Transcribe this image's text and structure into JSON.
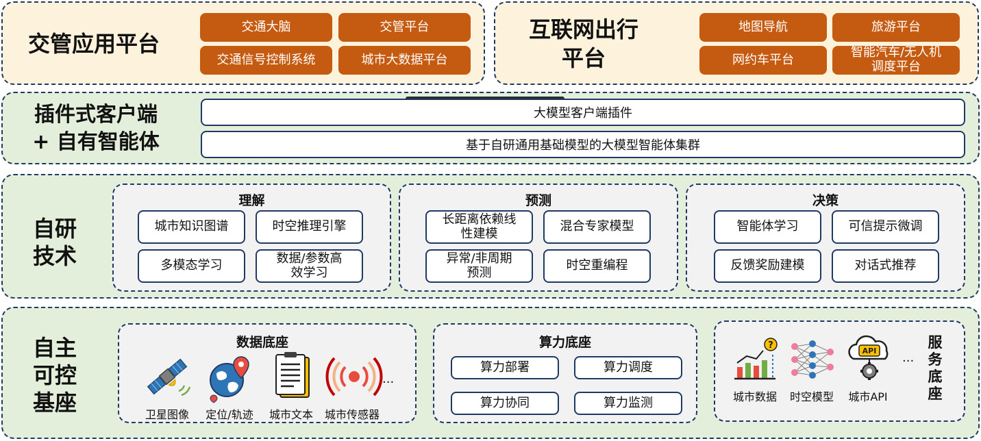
{
  "layer1": {
    "left": {
      "title": "交管应用平台",
      "items": [
        "交通大脑",
        "交管平台",
        "交通信号控制系统",
        "城市大数据平台"
      ]
    },
    "right": {
      "title_line1": "互联网出行",
      "title_line2": "平台",
      "items": [
        "地图导航",
        "旅游平台",
        "网约车平台",
        "智能汽车/无人机调度平台"
      ]
    },
    "colors": {
      "accent": "#c55a11",
      "background": "#fdf3dd"
    }
  },
  "layer2": {
    "title_line1": "插件式客户端",
    "title_line2": "+ 自有智能体",
    "bars": [
      "大模型客户端插件",
      "基于自研通用基础模型的大模型智能体集群"
    ],
    "colors": {
      "background": "#e3efda",
      "border": "#1f3864"
    }
  },
  "layer3": {
    "title_line1": "自研",
    "title_line2": "技术",
    "sections": [
      {
        "title": "理解",
        "items": [
          "城市知识图谱",
          "时空推理引擎",
          "多模态学习",
          "数据/参数高效学习"
        ]
      },
      {
        "title": "预测",
        "items": [
          "长距离依赖线性建模",
          "混合专家模型",
          "异常/非周期预测",
          "时空重编程"
        ]
      },
      {
        "title": "决策",
        "items": [
          "智能体学习",
          "可信提示微调",
          "反馈奖励建模",
          "对话式推荐"
        ]
      }
    ]
  },
  "layer4": {
    "title_chars": [
      "自主",
      "可控",
      "基座"
    ],
    "data_base": {
      "title": "数据底座",
      "icons": [
        {
          "name": "satellite-icon",
          "label": "卫星图像"
        },
        {
          "name": "globe-pin-icon",
          "label": "定位/轨迹"
        },
        {
          "name": "document-icon",
          "label": "城市文本"
        },
        {
          "name": "sensor-icon",
          "label": "城市传感器"
        }
      ],
      "ellipsis": "..."
    },
    "compute_base": {
      "title": "算力底座",
      "items": [
        "算力部署",
        "算力调度",
        "算力协同",
        "算力监测"
      ]
    },
    "service_base": {
      "icons": [
        {
          "name": "bar-chart-question-icon",
          "label": "城市数据"
        },
        {
          "name": "neural-network-icon",
          "label": "时空模型"
        },
        {
          "name": "api-cloud-gear-icon",
          "label": "城市API"
        }
      ],
      "ellipsis": "...",
      "vertical_title": [
        "服",
        "务",
        "底",
        "座"
      ]
    }
  }
}
